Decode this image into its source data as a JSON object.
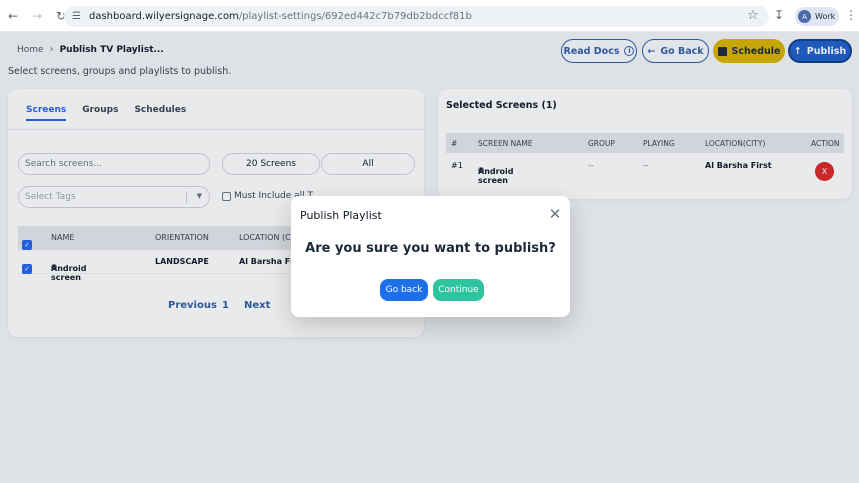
{
  "browser": {
    "url_host": "dashboard.wilyersignage.com",
    "url_path": "/playlist-settings/692ed442c7b79db2bdccf81b",
    "profile_label": "Work",
    "profile_initial": "A"
  },
  "breadcrumb": {
    "home": "Home",
    "current": "Publish TV Playlist..."
  },
  "subtitle": "Select screens, groups and playlists to publish.",
  "toolbar": {
    "read_docs": "Read Docs",
    "go_back": "Go Back",
    "schedule": "Schedule",
    "publish": "Publish"
  },
  "tabs": [
    "Screens",
    "Groups",
    "Schedules"
  ],
  "filters": {
    "search_placeholder": "Search screens...",
    "count_label": "20 Screens",
    "scope": "All",
    "tags_placeholder": "Select Tags",
    "must_include": "Must Include all T"
  },
  "left_table": {
    "headers": [
      "NAME",
      "ORIENTATION",
      "LOCATION (CITY)"
    ],
    "rows": [
      {
        "name": "Android screen",
        "orientation": "LANDSCAPE",
        "location": "Al Barsha First"
      }
    ]
  },
  "pagination": {
    "previous": "Previous",
    "page": "1",
    "next": "Next"
  },
  "selected": {
    "title": "Selected Screens (1)",
    "headers": [
      "#",
      "SCREEN NAME",
      "GROUP",
      "PLAYING",
      "LOCATION(CITY)",
      "ACTION"
    ],
    "rows": [
      {
        "index": "#1",
        "name": "Android screen",
        "group": "--",
        "playing": "--",
        "location": "Al Barsha First",
        "action": "X"
      }
    ]
  },
  "modal": {
    "title": "Publish Playlist",
    "question": "Are you sure you want to publish?",
    "go_back": "Go back",
    "continue": "Continue"
  },
  "colors": {
    "primary": "#1d6fe8",
    "continue": "#2ec4a0",
    "schedule": "#d9b400",
    "danger": "#dc2626"
  }
}
